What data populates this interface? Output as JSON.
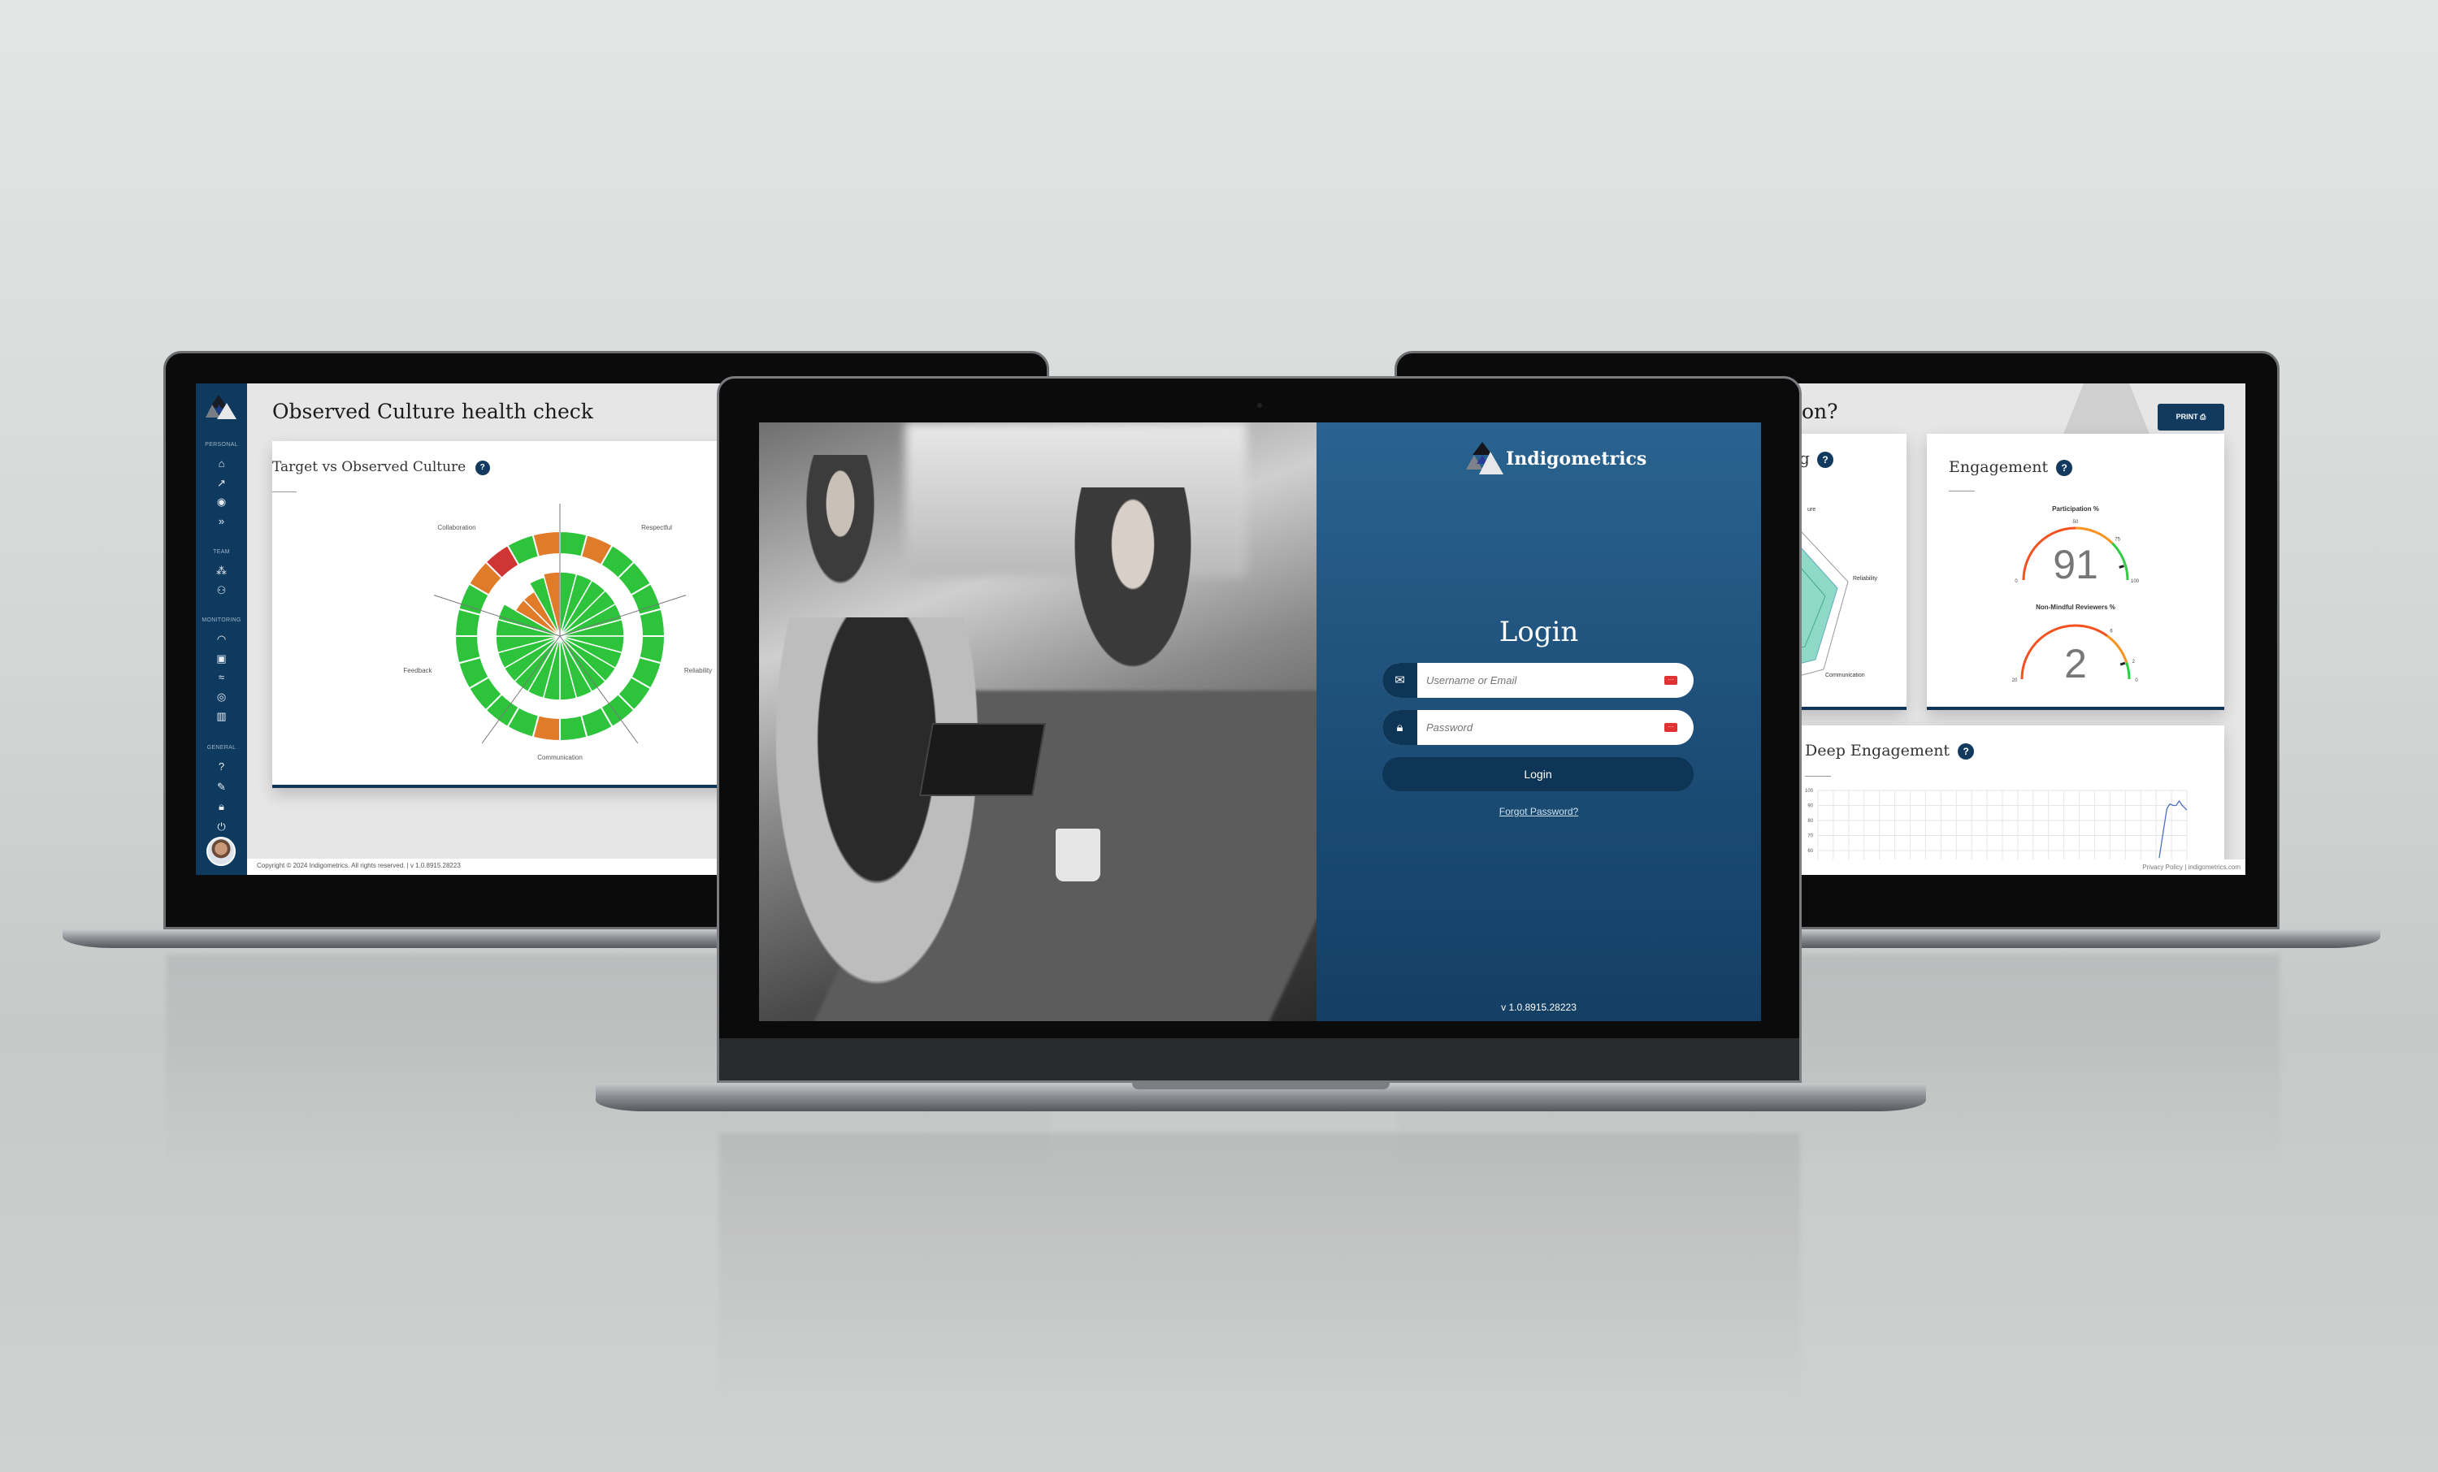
{
  "left_screen": {
    "page_title": "Observed Culture health check",
    "sidebar": {
      "sections": [
        {
          "label": "PERSONAL",
          "icons": [
            "home-icon",
            "chart-line-icon",
            "target-icon",
            "fast-forward-icon"
          ]
        },
        {
          "label": "TEAM",
          "icons": [
            "org-tree-icon",
            "users-icon"
          ]
        },
        {
          "label": "MONITORING",
          "icons": [
            "gauge-icon",
            "screen-search-icon",
            "trend-icon",
            "radar-icon",
            "bar-chart-icon"
          ]
        },
        {
          "label": "GENERAL",
          "icons": [
            "help-icon",
            "edit-document-icon",
            "lock-icon",
            "power-icon"
          ]
        }
      ]
    },
    "card": {
      "title": "Target vs Observed Culture",
      "help": "?"
    },
    "footer": "Copyright © 2024 Indigometrics. All rights reserved. | v 1.0.8915.28223",
    "chart_data": {
      "type": "polar",
      "axes": [
        "Collaboration",
        "Respectful",
        "Reliability",
        "Communication",
        "Feedback"
      ],
      "colors": {
        "good": "#2dc43c",
        "warning": "#e07b2a",
        "bad": "#d03535"
      },
      "outer_ring": [
        "good",
        "warning",
        "good",
        "good",
        "good",
        "good",
        "good",
        "good",
        "good",
        "good",
        "good",
        "good",
        "warning",
        "good",
        "good",
        "good",
        "good",
        "good",
        "good",
        "good",
        "warning",
        "bad",
        "good",
        "warning"
      ],
      "inner_values": [
        1,
        1,
        1,
        1,
        1,
        1,
        1,
        1,
        1,
        1,
        1,
        1,
        1,
        1,
        1,
        1,
        1,
        1,
        1,
        1,
        0.8,
        0.8,
        0.95,
        1
      ],
      "inner_status": [
        "good",
        "good",
        "good",
        "good",
        "good",
        "good",
        "good",
        "good",
        "good",
        "good",
        "good",
        "good",
        "good",
        "good",
        "good",
        "good",
        "good",
        "good",
        "good",
        "good",
        "warning",
        "warning",
        "good",
        "warning"
      ]
    }
  },
  "login": {
    "brand": "Indigometrics",
    "heading": "Login",
    "username_placeholder": "Username or Email",
    "password_placeholder": "Password",
    "login_button": "Login",
    "forgot_link": "Forgot Password?",
    "version": "v 1.0.8915.28223",
    "icons": {
      "username": "envelope-icon",
      "password": "lock-icon",
      "autofill": "password-manager-icon"
    }
  },
  "right_screen": {
    "title_fragment": "on?",
    "print_button": "PRINT",
    "partial_card": {
      "title_fragment": "g",
      "help": "?",
      "labels": [
        "ure",
        "Reliability",
        "Communication"
      ]
    },
    "engagement": {
      "title": "Engagement",
      "help": "?",
      "gauges": [
        {
          "label": "Participation %",
          "value": 91,
          "min": 0,
          "max": 100,
          "ticks": [
            0,
            50,
            75,
            100
          ],
          "bands": [
            {
              "from": 0,
              "to": 50,
              "color": "#f4511e"
            },
            {
              "from": 50,
              "to": 75,
              "color": "#f7931e"
            },
            {
              "from": 75,
              "to": 100,
              "color": "#2ecc40"
            }
          ]
        },
        {
          "label": "Non-Mindful Reviewers %",
          "value": 2,
          "min": 20,
          "max": 0,
          "ticks": [
            20,
            6,
            2,
            0
          ],
          "bands": [
            {
              "from": 20,
              "to": 6,
              "color": "#f4511e"
            },
            {
              "from": 6,
              "to": 2,
              "color": "#f7931e"
            },
            {
              "from": 2,
              "to": 0,
              "color": "#2ecc40"
            }
          ]
        }
      ]
    },
    "deep_engagement": {
      "title": "Deep Engagement",
      "help": "?",
      "chart_data": {
        "type": "line",
        "yticks": [
          100,
          90,
          80,
          70,
          60
        ],
        "ylim": [
          60,
          100
        ],
        "xlim": [
          0,
          24
        ],
        "grid": true,
        "color": "#4a6fc4",
        "points": [
          [
            22.2,
            55
          ],
          [
            22.5,
            75
          ],
          [
            22.7,
            88
          ],
          [
            22.9,
            91
          ],
          [
            23.1,
            90
          ],
          [
            23.3,
            90
          ],
          [
            23.5,
            93
          ],
          [
            23.7,
            90
          ],
          [
            24,
            87
          ]
        ]
      }
    },
    "footer": {
      "privacy": "Privacy Policy",
      "separator": "|",
      "site": "indigometrics.com"
    }
  }
}
